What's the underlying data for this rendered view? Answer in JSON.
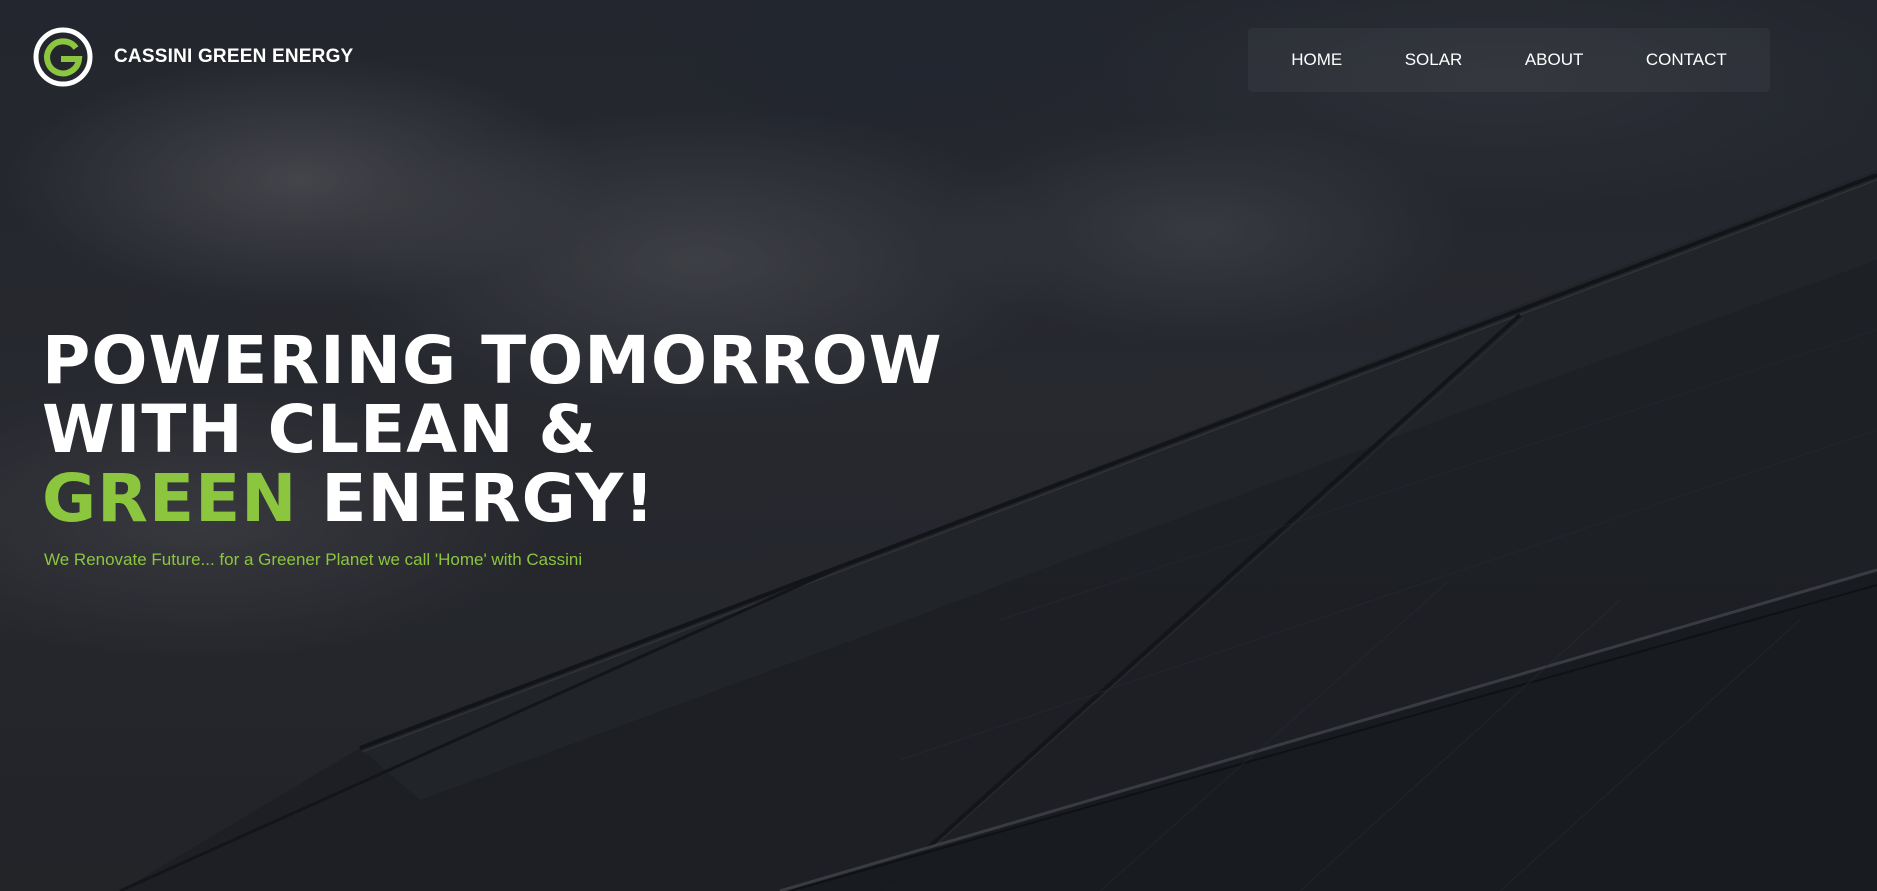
{
  "brand": {
    "name": "CASSINI GREEN ENERGY",
    "logo_icon": "cassini-g-logo-icon"
  },
  "nav": {
    "items": [
      {
        "label": "HOME"
      },
      {
        "label": "SOLAR"
      },
      {
        "label": "ABOUT"
      },
      {
        "label": "CONTACT"
      }
    ]
  },
  "hero": {
    "headline_line1": "POWERING TOMORROW",
    "headline_line2": "WITH CLEAN &",
    "headline_accent": "GREEN",
    "headline_line3_rest": " ENERGY!",
    "tagline": "We Renovate Future... for a Greener Planet we call 'Home' with Cassini",
    "background": "dark cloudy sky with solar panels"
  },
  "colors": {
    "accent": "#8cc63f",
    "text": "#ffffff"
  }
}
